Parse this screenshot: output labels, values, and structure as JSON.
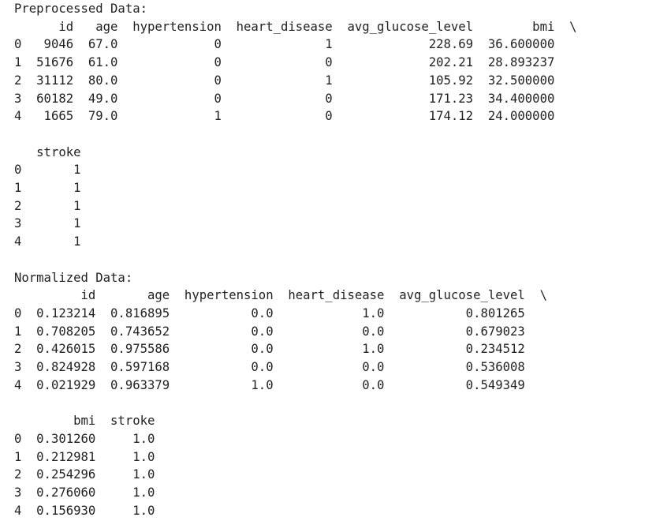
{
  "cell_output": {
    "lines": [
      "Preprocessed Data:",
      "      id   age  hypertension  heart_disease  avg_glucose_level        bmi  \\",
      "0   9046  67.0             0              1             228.69  36.600000   ",
      "1  51676  61.0             0              0             202.21  28.893237   ",
      "2  31112  80.0             0              1             105.92  32.500000   ",
      "3  60182  49.0             0              0             171.23  34.400000   ",
      "4   1665  79.0             1              0             174.12  24.000000   ",
      "",
      "   stroke  ",
      "0       1  ",
      "1       1  ",
      "2       1  ",
      "3       1  ",
      "4       1  ",
      "",
      "Normalized Data:",
      "         id       age  hypertension  heart_disease  avg_glucose_level  \\",
      "0  0.123214  0.816895           0.0            1.0           0.801265   ",
      "1  0.708205  0.743652           0.0            0.0           0.679023   ",
      "2  0.426015  0.975586           0.0            1.0           0.234512   ",
      "3  0.824928  0.597168           0.0            0.0           0.536008   ",
      "4  0.021929  0.963379           1.0            0.0           0.549349   ",
      "",
      "        bmi  stroke  ",
      "0  0.301260     1.0  ",
      "1  0.212981     1.0  ",
      "2  0.254296     1.0  ",
      "3  0.276060     1.0  ",
      "4  0.156930     1.0  "
    ]
  }
}
